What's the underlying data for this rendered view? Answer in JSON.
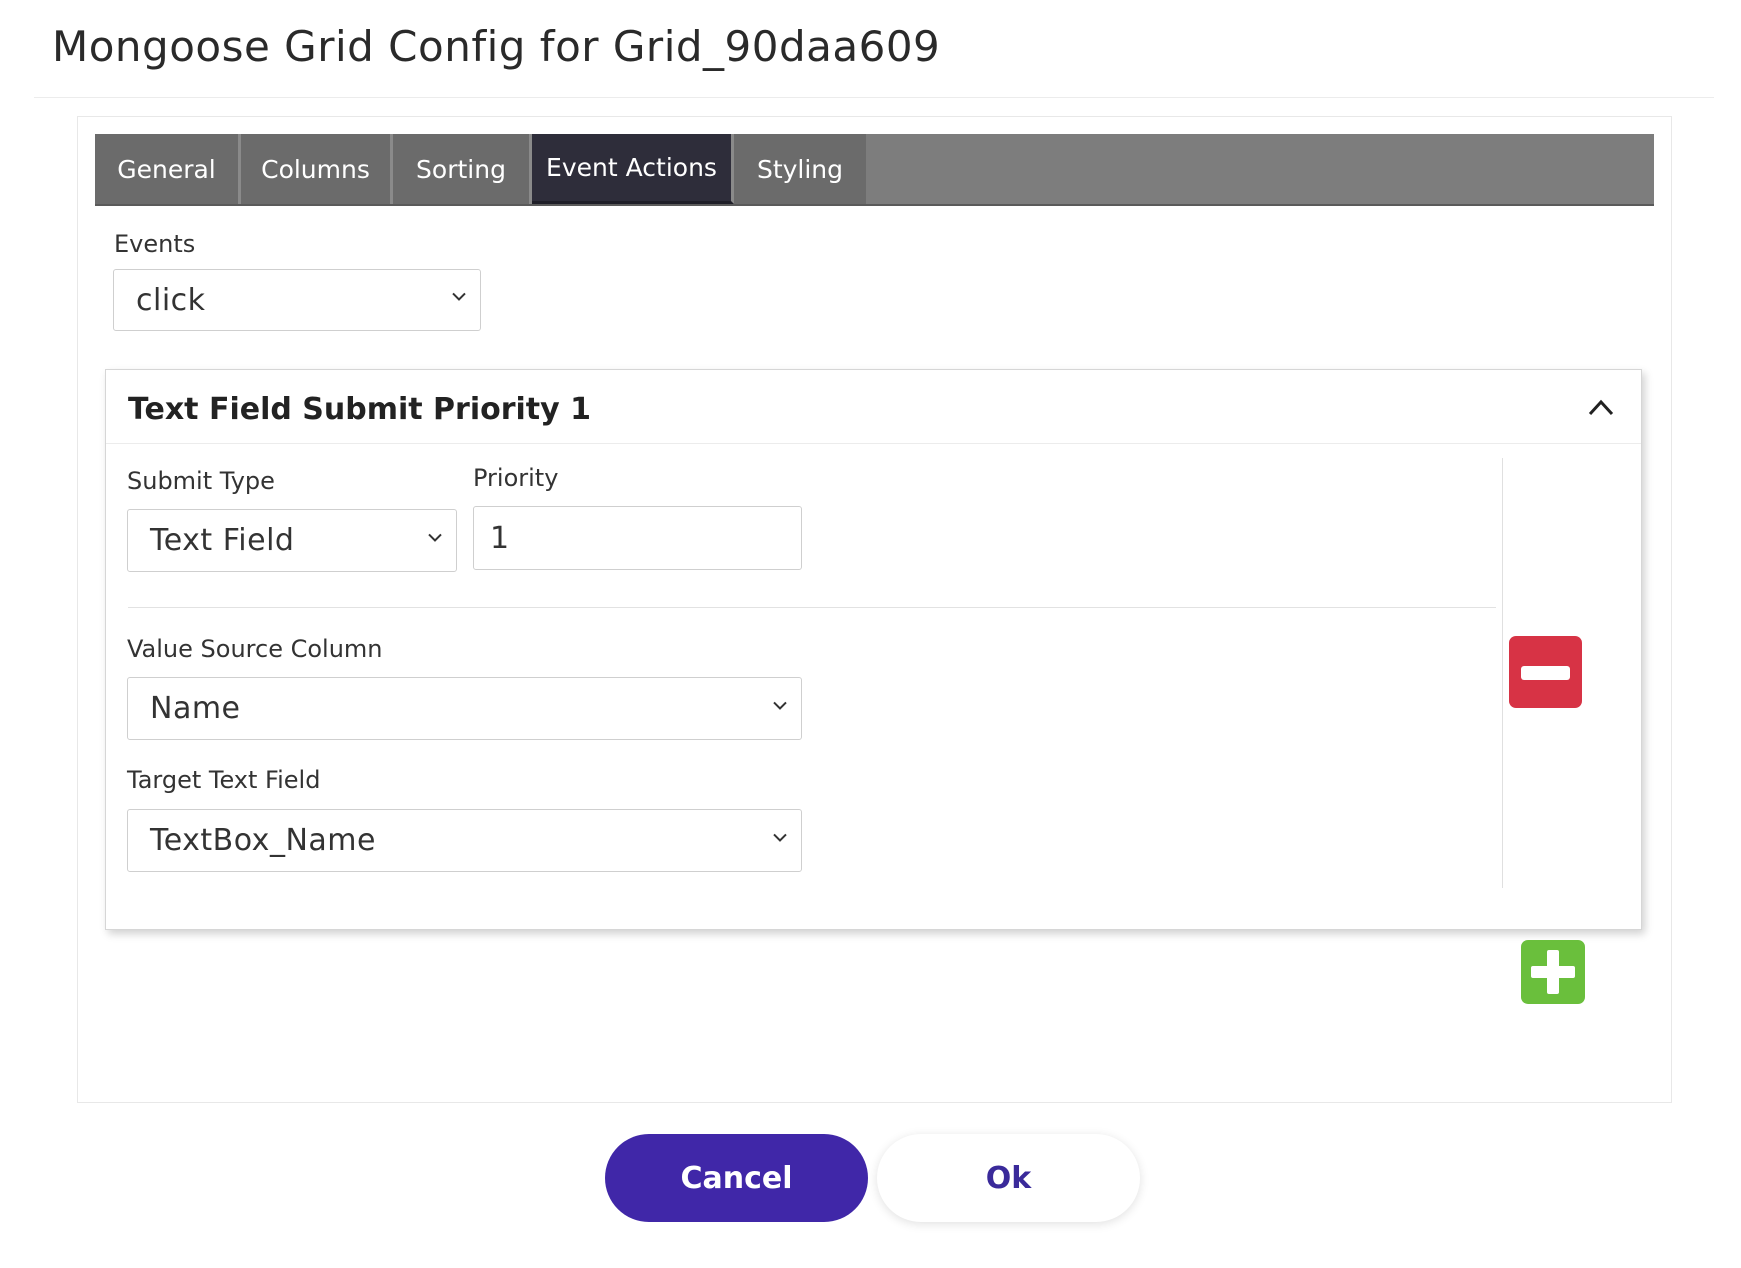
{
  "page": {
    "title": "Mongoose Grid Config for Grid_90daa609"
  },
  "tabs": [
    {
      "label": "General"
    },
    {
      "label": "Columns"
    },
    {
      "label": "Sorting"
    },
    {
      "label": "Event Actions"
    },
    {
      "label": "Styling"
    }
  ],
  "active_tab": "Event Actions",
  "events": {
    "label": "Events",
    "selected": "click"
  },
  "action_card": {
    "title": "Text Field Submit Priority 1",
    "submit_type": {
      "label": "Submit Type",
      "selected": "Text Field"
    },
    "priority": {
      "label": "Priority",
      "value": "1"
    },
    "value_source_column": {
      "label": "Value Source Column",
      "selected": "Name"
    },
    "target_text_field": {
      "label": "Target Text Field",
      "selected": "TextBox_Name"
    }
  },
  "footer": {
    "cancel_label": "Cancel",
    "ok_label": "Ok"
  },
  "colors": {
    "tabbar": "#7d7d7d",
    "active_tab": "#2e2d3a",
    "remove": "#d73345",
    "add": "#6abf3c",
    "primary": "#4027a8"
  }
}
